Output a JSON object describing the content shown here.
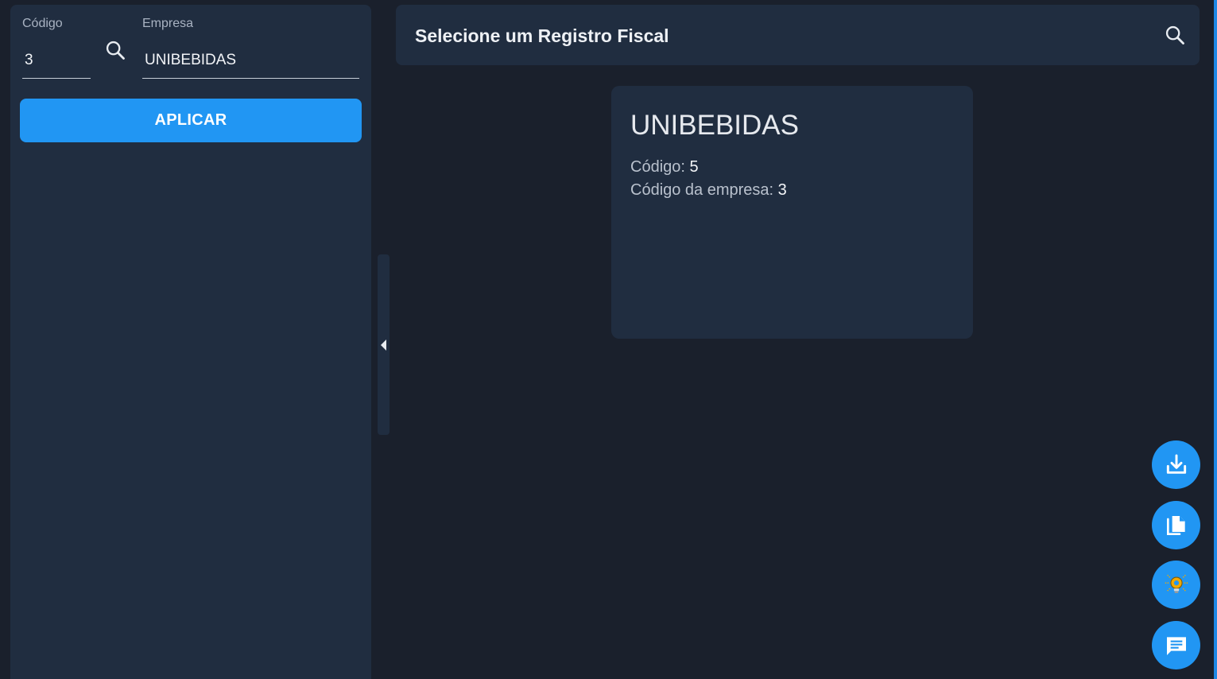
{
  "filters": {
    "codigo": {
      "label": "Código",
      "value": "3"
    },
    "empresa": {
      "label": "Empresa",
      "value": "UNIBEBIDAS"
    },
    "apply_label": "APLICAR"
  },
  "header": {
    "title": "Selecione um Registro Fiscal"
  },
  "records": [
    {
      "name": "UNIBEBIDAS",
      "codigo_label": "Código:",
      "codigo_value": "5",
      "empresa_label": "Código da empresa:",
      "empresa_value": "3"
    }
  ],
  "fabs": [
    {
      "icon": "download-icon"
    },
    {
      "icon": "copy-icon"
    },
    {
      "icon": "lightbulb-icon"
    },
    {
      "icon": "chat-icon"
    }
  ],
  "colors": {
    "background": "#1a202c",
    "panel": "#202d40",
    "accent": "#2196f3"
  }
}
